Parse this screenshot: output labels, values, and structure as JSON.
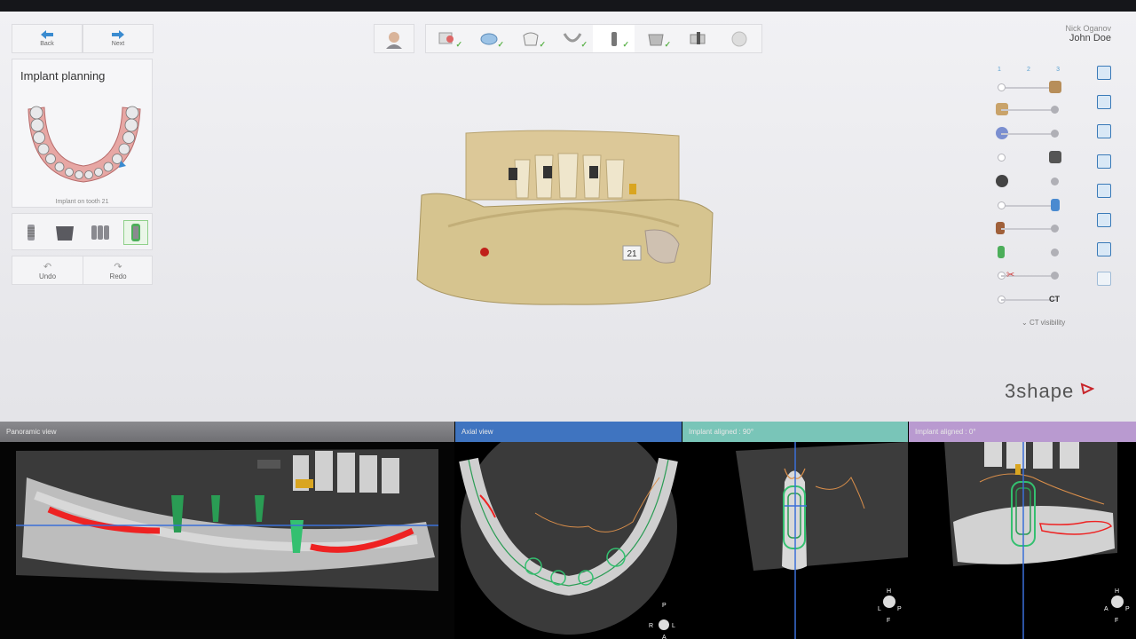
{
  "nav": {
    "back_label": "Back",
    "next_label": "Next"
  },
  "planning": {
    "title": "Implant planning",
    "subtitle": "Implant on tooth 21"
  },
  "history": {
    "undo_label": "Undo",
    "redo_label": "Redo"
  },
  "user": {
    "org": "Nick Oganov",
    "name": "John  Doe"
  },
  "visibility": {
    "columns": [
      "1",
      "2",
      "3"
    ],
    "ct_label": "CT",
    "ct_visibility_label": "CT visibility"
  },
  "model": {
    "tooth_tag": "21"
  },
  "brand": {
    "name": "3shape"
  },
  "views": {
    "panoramic": "Panoramic view",
    "axial": "Axial view",
    "aligned90": "Implant aligned : 90°",
    "aligned0": "Implant aligned : 0°"
  },
  "orientation": {
    "axial": [
      "P",
      "R",
      "L",
      "A"
    ],
    "aligned90": [
      "H",
      "L",
      "P",
      "F"
    ],
    "aligned0": [
      "H",
      "A",
      "P",
      "F"
    ]
  },
  "colors": {
    "accent": "#3a7ab8",
    "check": "#5bb24a",
    "axial_header": "#3f74c0",
    "aligned90_header": "#79c5b8",
    "aligned0_header": "#b99ad0"
  }
}
